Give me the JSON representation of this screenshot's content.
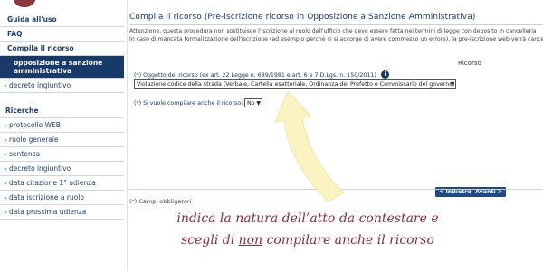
{
  "sidebar": {
    "top_items": [
      {
        "label": "Guida all'uso"
      },
      {
        "label": "FAQ"
      },
      {
        "label": "Compila il ricorso"
      }
    ],
    "active_item": "opposizione a sanzione amministrativa",
    "decreto_item": "decreto ingiuntivo",
    "section_title": "Ricerche",
    "search_items": [
      {
        "label": "protocollo WEB"
      },
      {
        "label": "ruolo generale"
      },
      {
        "label": "sentenza"
      },
      {
        "label": "decreto ingiuntivo"
      },
      {
        "label": "data citazione 1° udienza"
      },
      {
        "label": "data iscrizione a ruolo"
      },
      {
        "label": "data prossima udienza"
      }
    ]
  },
  "main": {
    "title": "Compila il ricorso (Pre-iscrizione ricorso in Opposizione a Sanzione Amministrativa)",
    "intro_line1": "Attenzione, questa procedura non sostituisce l'iscrizione al ruolo dell'ufficio che deve essere fatta nei termini di legge con deposito in cancelleria",
    "intro_line2": "In caso di mancata formalizzazione dell'iscrizione (ad esempio perchè ci si accorge di avere commesso un errore), la pre-iscrizione web verrà cancellata",
    "section_label": "Ricorso",
    "oggetto_label": "(*) Oggetto del ricorso (ex art. 22 Legge n. 689/1981 e art. 6 e 7 D.Lgs. n. 150/2011)",
    "oggetto_value": "Violazione codice della strada (Verbale, Cartella esattoriale, Ordinanza del Prefetto o Commissario del governo)",
    "compila_label": "(*) Si vuole compilare anche il ricorso?",
    "compila_value": "No",
    "btn_back": "< Indietro",
    "btn_next": "Avanti >",
    "footnote": "(*) Campi obbligatori"
  },
  "annotation": {
    "line1": "indica la natura dell’atto da contestare e",
    "line2_prefix": "scegli di ",
    "line2_underlined": "non",
    "line2_suffix": " compilare anche il ricorso"
  },
  "colors": {
    "nav_blue": "#173a6b",
    "button_blue": "#1f4a86",
    "annotation_text": "#8a2a3a",
    "arrow_fill": "#fbf3c2"
  },
  "icons": {
    "info": "info-icon",
    "chevron": "chevron-down-icon"
  }
}
